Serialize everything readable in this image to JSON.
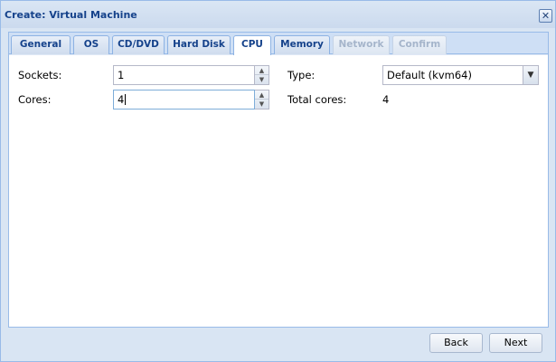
{
  "window": {
    "title": "Create: Virtual Machine",
    "close_glyph": "✕"
  },
  "tabs": [
    {
      "label": "General",
      "state": "normal"
    },
    {
      "label": "OS",
      "state": "normal"
    },
    {
      "label": "CD/DVD",
      "state": "normal"
    },
    {
      "label": "Hard Disk",
      "state": "normal"
    },
    {
      "label": "CPU",
      "state": "active"
    },
    {
      "label": "Memory",
      "state": "normal"
    },
    {
      "label": "Network",
      "state": "disabled"
    },
    {
      "label": "Confirm",
      "state": "disabled"
    }
  ],
  "cpu": {
    "sockets_label": "Sockets:",
    "sockets_value": "1",
    "cores_label": "Cores:",
    "cores_value": "4",
    "type_label": "Type:",
    "type_value": "Default (kvm64)",
    "total_cores_label": "Total cores:",
    "total_cores_value": "4"
  },
  "buttons": {
    "back": "Back",
    "next": "Next"
  },
  "icons": {
    "spin_up": "spinner-up-icon",
    "spin_down": "spinner-down-icon",
    "dropdown": "chevron-down-icon",
    "close": "close-icon"
  }
}
